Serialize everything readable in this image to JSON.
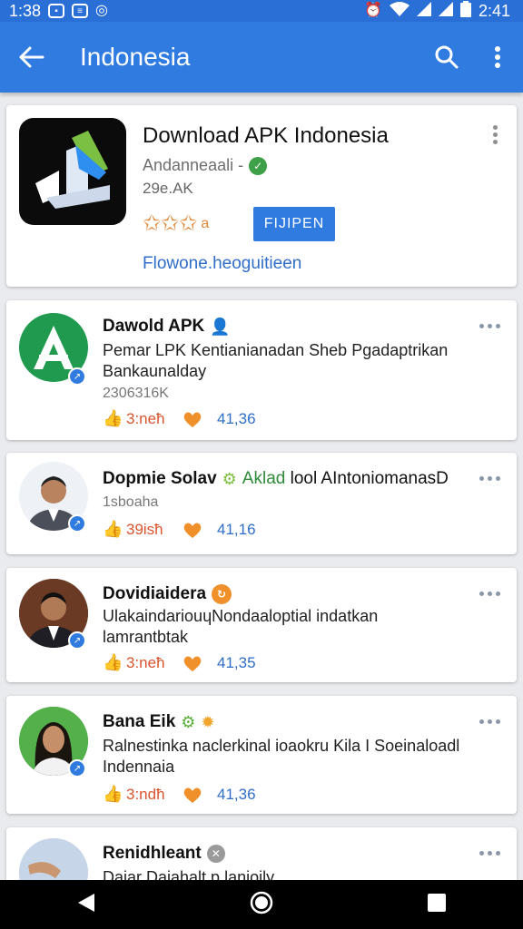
{
  "status_bar": {
    "time_left": "1:38",
    "time_right": "2:41",
    "icons_left": [
      "message-icon",
      "doc-icon",
      "circle-icon"
    ],
    "icons_right": [
      "alarm-icon",
      "wifi-icon",
      "signal-icon",
      "signal-icon",
      "battery-icon"
    ]
  },
  "app_bar": {
    "title": "Indonesia",
    "icons": [
      "back-arrow-icon",
      "search-icon",
      "more-vert-icon"
    ],
    "color": "#2f7be0"
  },
  "featured_app": {
    "title": "Download APK Indonesia",
    "developer": "Andanneaali -",
    "size": "29e.AK",
    "stars": "✩✩✩",
    "star_suffix": "a",
    "button_label": "FIJIPEN",
    "link_text": "Flowone.heoguitieen"
  },
  "posts": [
    {
      "name": "Dawold APK",
      "line1": "Pemar LPK Kentianianadan Sheb Pgadaptrikan",
      "line2": "Bankaunalday",
      "meta": "2306316K",
      "likes": "3:neħ",
      "shares": "41,36"
    },
    {
      "name": "Dopmie Solav",
      "extra_green": "Aklad",
      "extra": "lool AIntoniomanasD",
      "meta": "1sboaha",
      "likes": "39isħ",
      "shares": "41,16"
    },
    {
      "name": "Dovidiaidera",
      "line1": "UlakaindariouɥNondaaloptial  indatkan",
      "line2": "lamrantbtak",
      "likes": "3:neħ",
      "shares": "41,35"
    },
    {
      "name": "Bana Eik",
      "line1": "Ralnestinka naclerkinal ioaokru Kila I Soeinaloadl",
      "line2": "Indennaia",
      "likes": "3:ndħ",
      "shares": "41,36"
    },
    {
      "name": "Renidhleant",
      "line1": "Daiar Daiahalt p lanioily"
    }
  ],
  "nav_bar": {
    "icons": [
      "back-triangle-icon",
      "home-circle-icon",
      "recents-square-icon"
    ]
  }
}
